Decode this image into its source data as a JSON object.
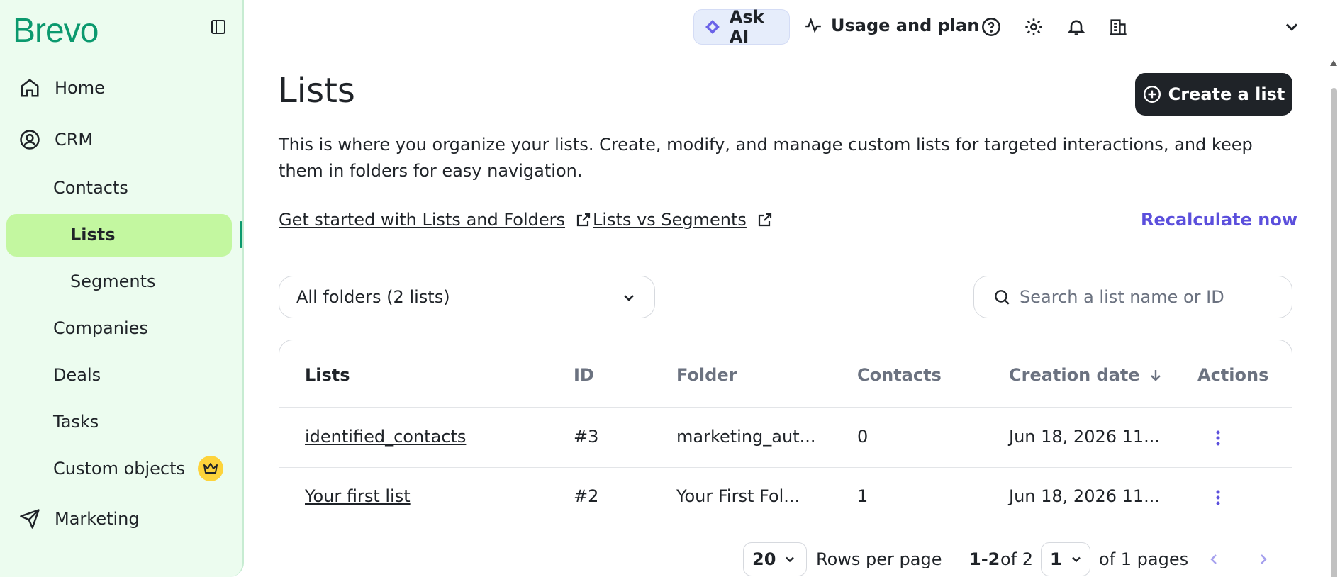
{
  "brand": {
    "logo": "Brevo"
  },
  "sidebar": {
    "items": [
      {
        "label": "Home"
      },
      {
        "label": "CRM"
      },
      {
        "label": "Contacts"
      },
      {
        "label": "Lists"
      },
      {
        "label": "Segments"
      },
      {
        "label": "Companies"
      },
      {
        "label": "Deals"
      },
      {
        "label": "Tasks"
      },
      {
        "label": "Custom objects"
      },
      {
        "label": "Marketing"
      }
    ],
    "active": "Lists"
  },
  "topbar": {
    "ask_ai": "Ask AI",
    "usage": "Usage and plan"
  },
  "page": {
    "title": "Lists",
    "create_button": "Create a list",
    "description": "This is where you organize your lists. Create, modify, and manage custom lists for targeted interactions, and keep them in folders for easy navigation.",
    "links": [
      {
        "label": "Get started with Lists and Folders"
      },
      {
        "label": "Lists vs Segments"
      }
    ],
    "recalculate": "Recalculate now",
    "folder_filter": "All folders (2 lists)",
    "search_placeholder": "Search a list name or ID"
  },
  "table": {
    "columns": [
      "Lists",
      "ID",
      "Folder",
      "Contacts",
      "Creation date",
      "Actions"
    ],
    "rows": [
      {
        "name": "identified_contacts",
        "id": "#3",
        "folder": "marketing_aut...",
        "contacts": "0",
        "created": "Jun 18, 2026 11..."
      },
      {
        "name": "Your first list",
        "id": "#2",
        "folder": "Your First Fol...",
        "contacts": "1",
        "created": "Jun 18, 2026 11..."
      }
    ]
  },
  "pagination": {
    "rows_per_page_value": "20",
    "rows_per_page_label": "Rows per page",
    "range_bold": "1-2",
    "range_rest": "of 2",
    "page_value": "1",
    "pages_label": "of 1 pages"
  },
  "colors": {
    "brand_green": "#0b996e",
    "active_bg": "#c3f7a0",
    "accent_purple": "#5b4fdc",
    "sidebar_bg": "#ecfcef"
  }
}
